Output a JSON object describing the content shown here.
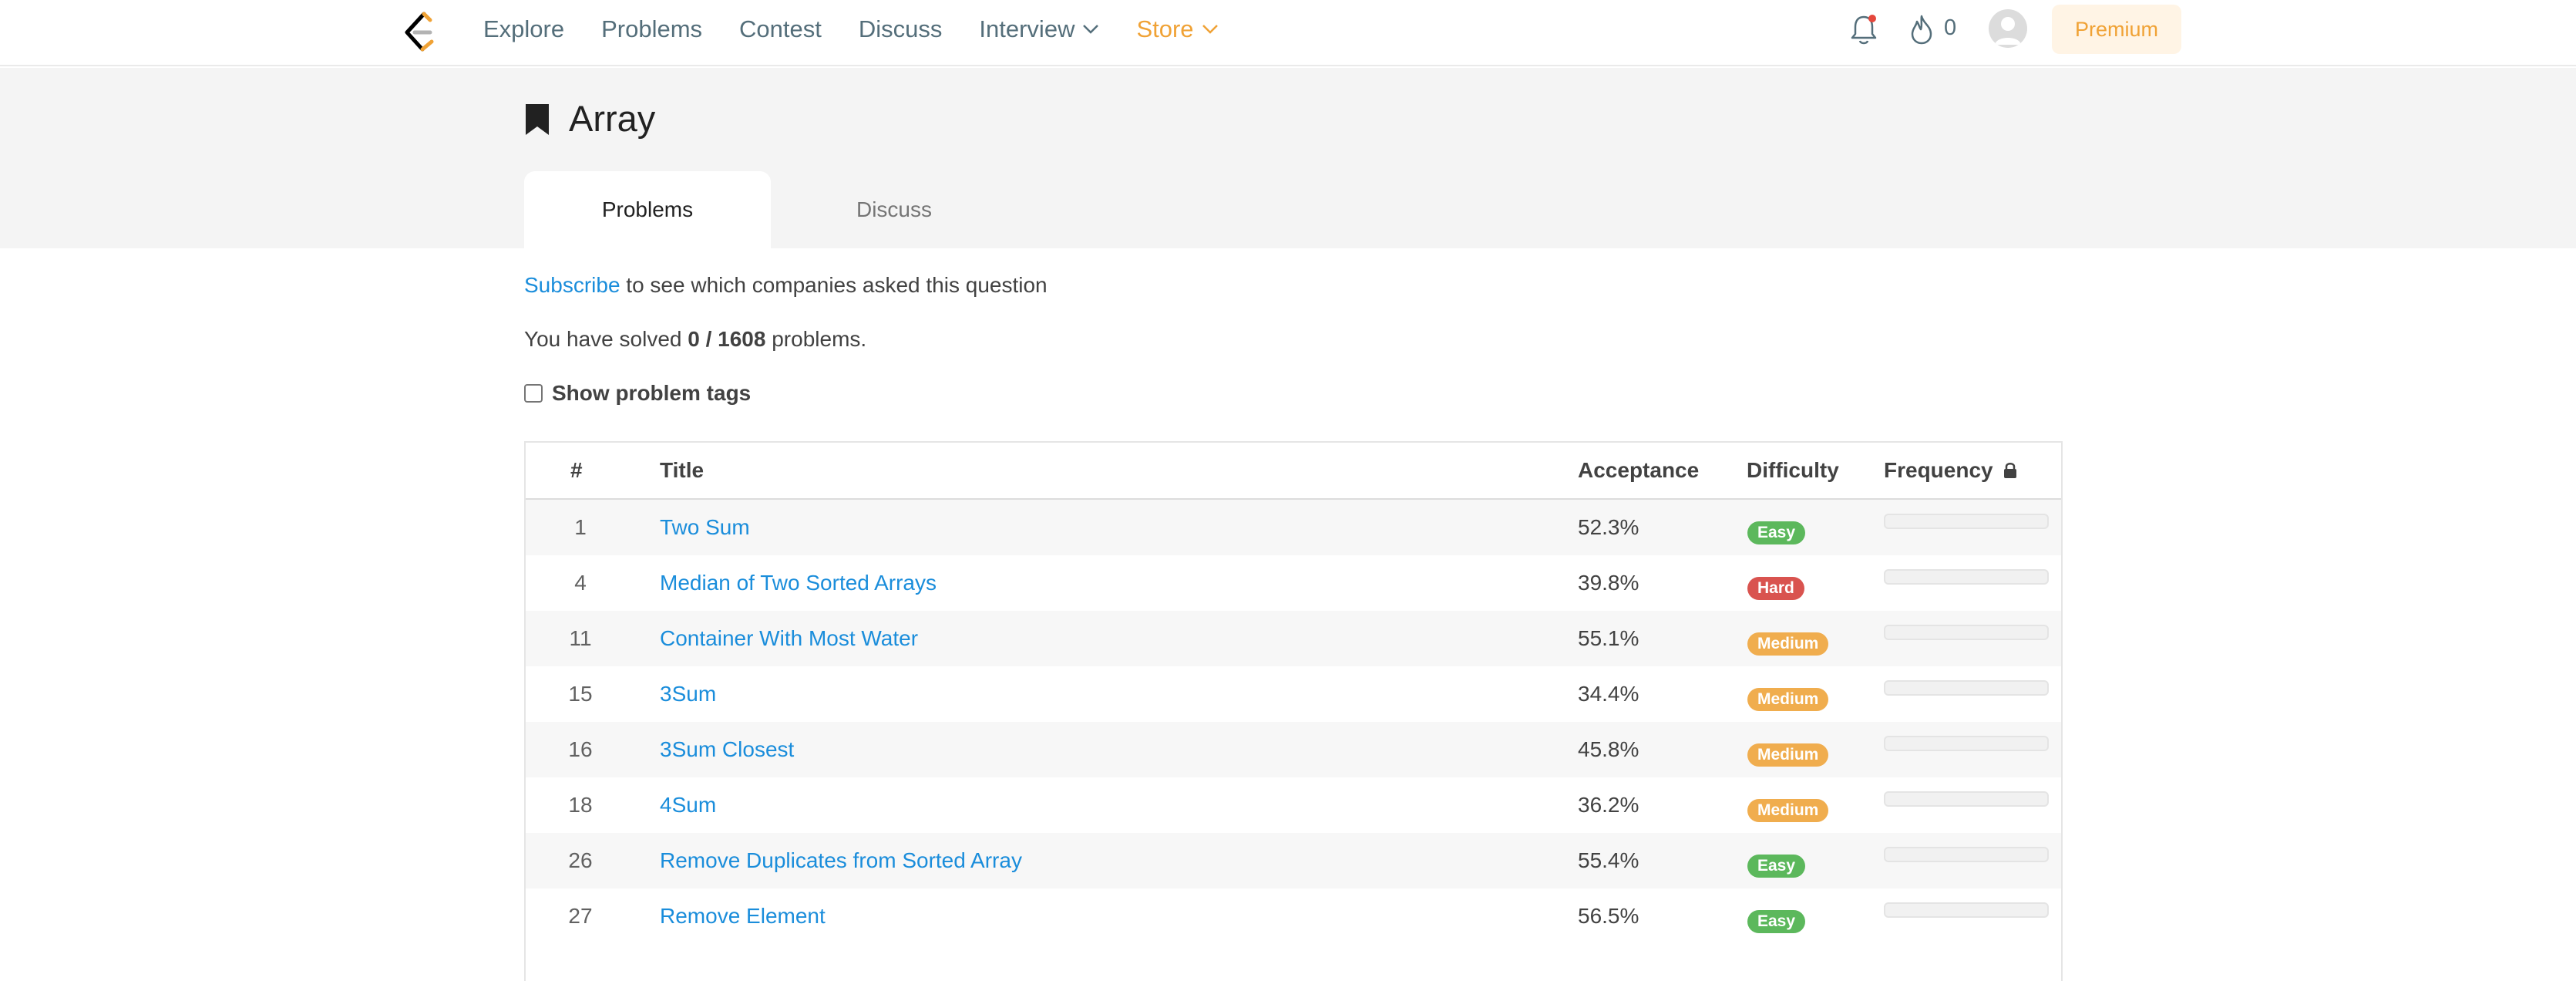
{
  "nav": {
    "links": [
      "Explore",
      "Problems",
      "Contest",
      "Discuss",
      "Interview",
      "Store"
    ],
    "fire_count": "0",
    "premium_label": "Premium"
  },
  "tag": {
    "title": "Array"
  },
  "tabs": [
    "Problems",
    "Discuss"
  ],
  "subscribe": {
    "link": "Subscribe",
    "rest": " to see which companies asked this question"
  },
  "solved": {
    "prefix": "You have solved ",
    "count": "0 / 1608",
    "suffix": " problems."
  },
  "show_tags_label": "Show problem tags",
  "table": {
    "headers": [
      "#",
      "Title",
      "Acceptance",
      "Difficulty",
      "Frequency"
    ],
    "rows": [
      {
        "num": "1",
        "title": "Two Sum",
        "acceptance": "52.3%",
        "difficulty": "Easy"
      },
      {
        "num": "4",
        "title": "Median of Two Sorted Arrays",
        "acceptance": "39.8%",
        "difficulty": "Hard"
      },
      {
        "num": "11",
        "title": "Container With Most Water",
        "acceptance": "55.1%",
        "difficulty": "Medium"
      },
      {
        "num": "15",
        "title": "3Sum",
        "acceptance": "34.4%",
        "difficulty": "Medium"
      },
      {
        "num": "16",
        "title": "3Sum Closest",
        "acceptance": "45.8%",
        "difficulty": "Medium"
      },
      {
        "num": "18",
        "title": "4Sum",
        "acceptance": "36.2%",
        "difficulty": "Medium"
      },
      {
        "num": "26",
        "title": "Remove Duplicates from Sorted Array",
        "acceptance": "55.4%",
        "difficulty": "Easy"
      },
      {
        "num": "27",
        "title": "Remove Element",
        "acceptance": "56.5%",
        "difficulty": "Easy"
      }
    ]
  },
  "colors": {
    "link": "#1a8ddb",
    "store": "#f0a235",
    "easy": "#5cb85c",
    "medium": "#f0ad4e",
    "hard": "#d9534f"
  },
  "icons": {
    "logo": "leetcode-logo",
    "bell": "bell-icon",
    "fire": "fire-icon",
    "lock": "lock-icon",
    "bookmark": "bookmark-icon"
  }
}
